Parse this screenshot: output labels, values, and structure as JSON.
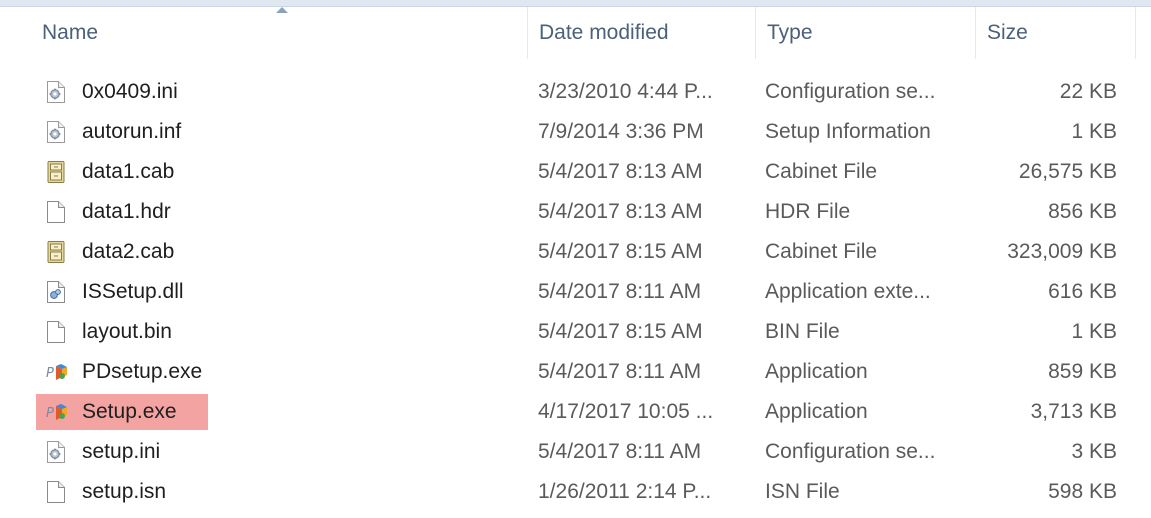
{
  "columns": {
    "name": "Name",
    "date": "Date modified",
    "type": "Type",
    "size": "Size"
  },
  "files": [
    {
      "name": "0x0409.ini",
      "date": "3/23/2010 4:44 P...",
      "type": "Configuration se...",
      "size": "22 KB",
      "icon": "settings-file-icon"
    },
    {
      "name": "autorun.inf",
      "date": "7/9/2014 3:36 PM",
      "type": "Setup Information",
      "size": "1 KB",
      "icon": "settings-file-icon"
    },
    {
      "name": "data1.cab",
      "date": "5/4/2017 8:13 AM",
      "type": "Cabinet File",
      "size": "26,575 KB",
      "icon": "cabinet-file-icon"
    },
    {
      "name": "data1.hdr",
      "date": "5/4/2017 8:13 AM",
      "type": "HDR File",
      "size": "856 KB",
      "icon": "blank-file-icon"
    },
    {
      "name": "data2.cab",
      "date": "5/4/2017 8:15 AM",
      "type": "Cabinet File",
      "size": "323,009 KB",
      "icon": "cabinet-file-icon"
    },
    {
      "name": "ISSetup.dll",
      "date": "5/4/2017 8:11 AM",
      "type": "Application exte...",
      "size": "616 KB",
      "icon": "dll-file-icon"
    },
    {
      "name": "layout.bin",
      "date": "5/4/2017 8:15 AM",
      "type": "BIN File",
      "size": "1 KB",
      "icon": "blank-file-icon"
    },
    {
      "name": "PDsetup.exe",
      "date": "5/4/2017 8:11 AM",
      "type": "Application",
      "size": "859 KB",
      "icon": "installer-app-icon"
    },
    {
      "name": "Setup.exe",
      "date": "4/17/2017 10:05 ...",
      "type": "Application",
      "size": "3,713 KB",
      "icon": "installer-app-icon",
      "highlighted": true
    },
    {
      "name": "setup.ini",
      "date": "5/4/2017 8:11 AM",
      "type": "Configuration se...",
      "size": "3 KB",
      "icon": "settings-file-icon"
    },
    {
      "name": "setup.isn",
      "date": "1/26/2011 2:14 P...",
      "type": "ISN File",
      "size": "598 KB",
      "icon": "blank-file-icon"
    }
  ],
  "colors": {
    "header_text": "#4c607a",
    "highlight": "#f4a3a3"
  }
}
